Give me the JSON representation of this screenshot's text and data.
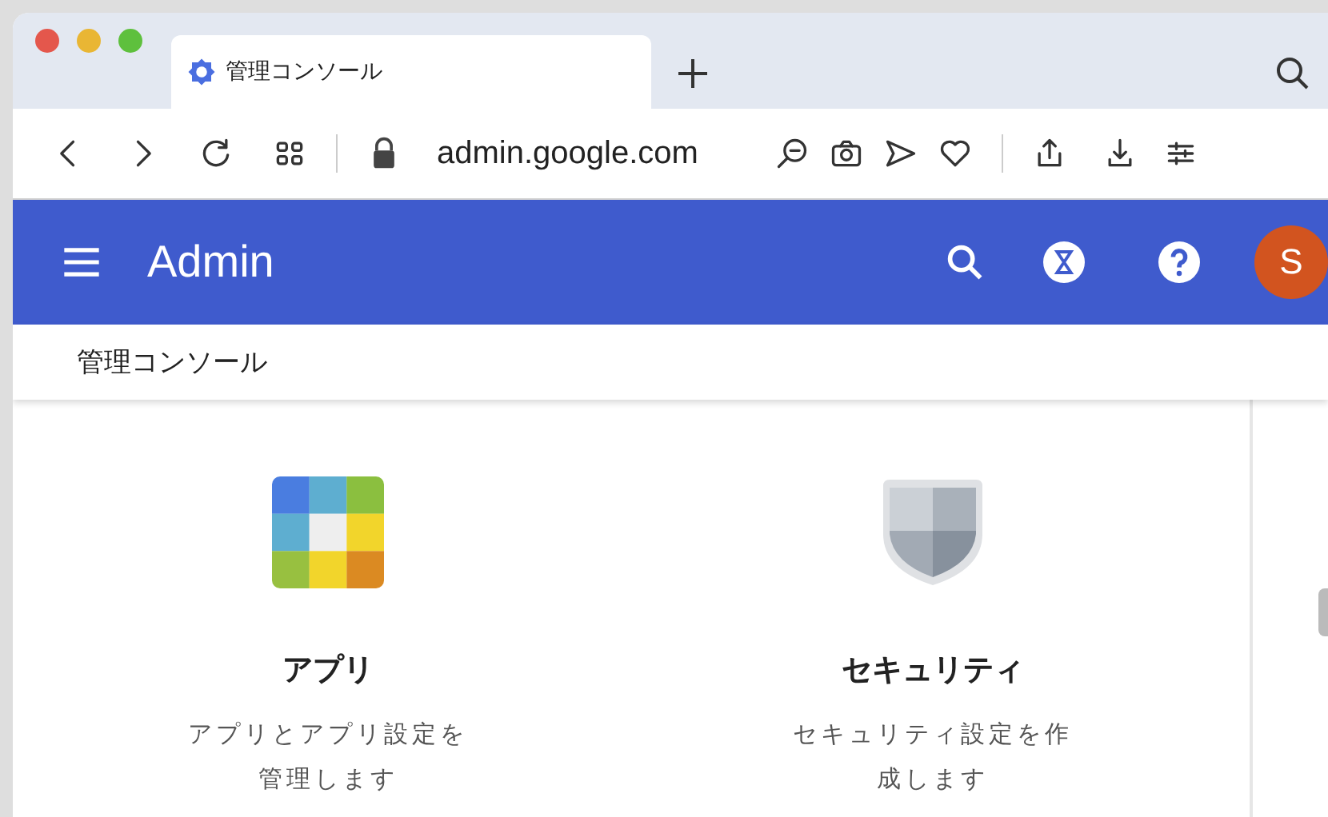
{
  "browser": {
    "tab": {
      "title": "管理コンソール",
      "selected": true
    },
    "url": "admin.google.com"
  },
  "app_bar": {
    "title": "Admin",
    "avatar": "S"
  },
  "breadcrumb": "管理コンソール",
  "cards": [
    {
      "kind": "apps",
      "title": "アプリ",
      "description": "アプリとアプリ設定を管理します"
    },
    {
      "kind": "security",
      "title": "セキュリティ",
      "description": "セキュリティ設定を作成します"
    }
  ]
}
